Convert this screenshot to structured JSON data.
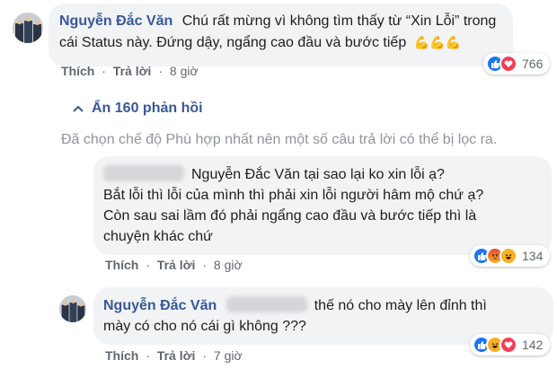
{
  "comments": [
    {
      "author": "Nguyễn Đắc Văn",
      "text_line1": "Chú rất mừng vì không tìm thấy từ “Xin Lỗi” trong",
      "text_line2": "cái Status này. Đứng dậy, ngẩng cao đầu và bước tiếp",
      "emoji": "💪💪💪",
      "like_label": "Thích",
      "reply_label": "Trả lời",
      "time": "8 giờ",
      "reaction_count": "766",
      "reaction_icons": [
        "like-icon",
        "love-icon"
      ]
    },
    {
      "text_line1": "Nguyễn Đắc Văn tại sao lại ko xin lỗi ạ?",
      "text_line2": "Bắt lỗi thì lỗi của mình thì phải xin lỗi người hâm mộ chứ ạ?",
      "text_line3": "Còn sau sai lầm đó phải ngẩng cao đầu và bước tiếp thì là",
      "text_line4": "chuyện khác chứ",
      "like_label": "Thích",
      "reply_label": "Trả lời",
      "time": "8 giờ",
      "reaction_count": "134",
      "reaction_icons": [
        "like-icon",
        "angry-icon",
        "haha-icon"
      ]
    },
    {
      "author": "Nguyễn Đắc Văn",
      "text_line1": "thế nó cho mày lên đỉnh thì",
      "text_line2": "mày có cho nó cái gì không ???",
      "like_label": "Thích",
      "reply_label": "Trả lời",
      "time": "7 giờ",
      "reaction_count": "142",
      "reaction_icons": [
        "like-icon",
        "haha-icon",
        "love-icon"
      ]
    }
  ],
  "replies_toggle": "Ẩn 160 phản hồi",
  "filter_note": "Đã chọn chế độ Phù hợp nhất nên một số câu trả lời có thể bị lọc ra.",
  "colors": {
    "like": "#1877f2",
    "love": "#f33e58",
    "haha": "#f7b125",
    "angry": "#e9710f",
    "link": "#385898",
    "bubble": "#f2f3f5"
  }
}
